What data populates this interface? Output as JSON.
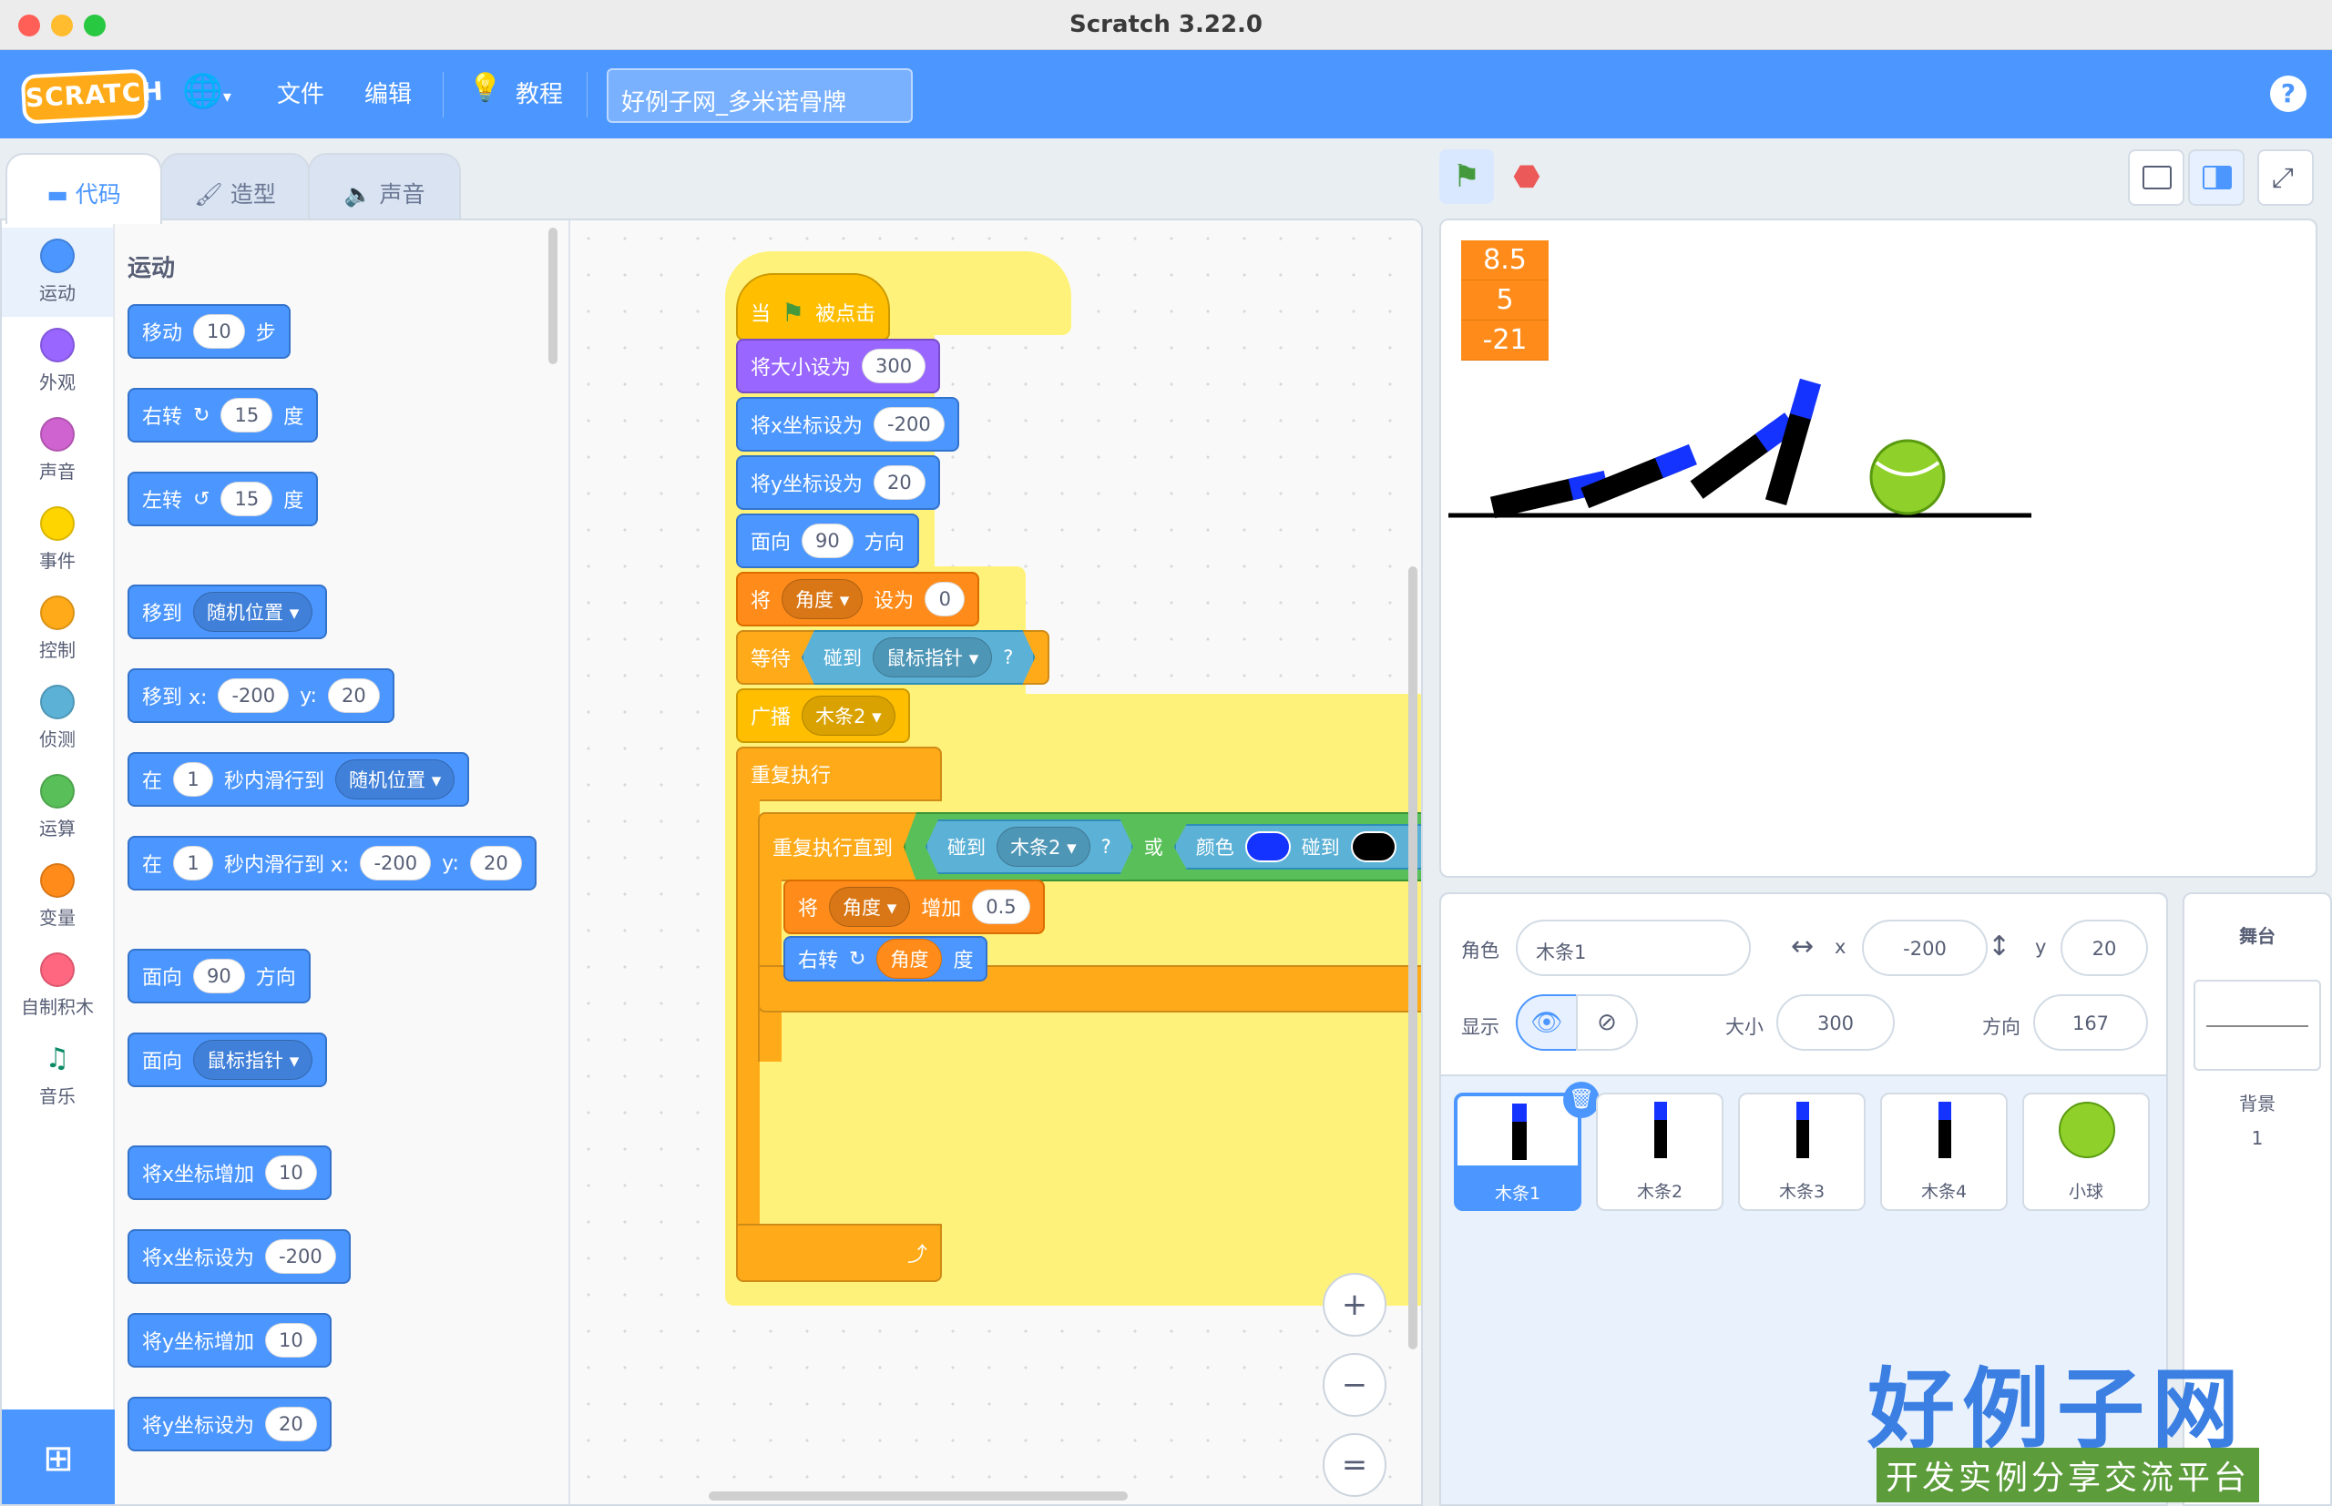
{
  "window": {
    "title": "Scratch 3.22.0"
  },
  "menubar": {
    "logo": "SCRATCH",
    "file": "文件",
    "edit": "编辑",
    "tutorials": "教程",
    "project_title": "好例子网_多米诺骨牌",
    "help": "?"
  },
  "tabs": {
    "code": "代码",
    "costumes": "造型",
    "sounds": "声音"
  },
  "categories": [
    {
      "label": "运动",
      "color": "#4c97ff"
    },
    {
      "label": "外观",
      "color": "#9966ff"
    },
    {
      "label": "声音",
      "color": "#cf63cf"
    },
    {
      "label": "事件",
      "color": "#ffd500"
    },
    {
      "label": "控制",
      "color": "#ffab19"
    },
    {
      "label": "侦测",
      "color": "#5cb1d6"
    },
    {
      "label": "运算",
      "color": "#59c059"
    },
    {
      "label": "变量",
      "color": "#ff8c1a"
    },
    {
      "label": "自制积木",
      "color": "#ff6680"
    },
    {
      "label": "音乐",
      "color": "#0fbd8c"
    }
  ],
  "palette": {
    "heading": "运动",
    "move": {
      "a": "移动",
      "v": "10",
      "b": "步"
    },
    "turn_right": {
      "a": "右转",
      "v": "15",
      "b": "度"
    },
    "turn_left": {
      "a": "左转",
      "v": "15",
      "b": "度"
    },
    "goto": {
      "a": "移到",
      "d": "随机位置"
    },
    "goto_xy": {
      "a": "移到 x:",
      "x": "-200",
      "b": "y:",
      "y": "20"
    },
    "glide": {
      "a": "在",
      "v": "1",
      "b": "秒内滑行到",
      "d": "随机位置"
    },
    "glide_xy": {
      "a": "在",
      "v": "1",
      "b": "秒内滑行到 x:",
      "x": "-200",
      "c": "y:",
      "y": "20"
    },
    "point_dir": {
      "a": "面向",
      "v": "90",
      "b": "方向"
    },
    "point_towards": {
      "a": "面向",
      "d": "鼠标指针"
    },
    "change_x": {
      "a": "将x坐标增加",
      "v": "10"
    },
    "set_x": {
      "a": "将x坐标设为",
      "v": "-200"
    },
    "change_y": {
      "a": "将y坐标增加",
      "v": "10"
    },
    "set_y": {
      "a": "将y坐标设为",
      "v": "20"
    }
  },
  "script": {
    "hat": {
      "a": "当",
      "b": "被点击"
    },
    "set_size": {
      "a": "将大小设为",
      "v": "300"
    },
    "set_x": {
      "a": "将x坐标设为",
      "v": "-200"
    },
    "set_y": {
      "a": "将y坐标设为",
      "v": "20"
    },
    "point": {
      "a": "面向",
      "v": "90",
      "b": "方向"
    },
    "set_var": {
      "a": "将",
      "var": "角度",
      "b": "设为",
      "v": "0"
    },
    "wait_until": {
      "a": "等待",
      "touch": "碰到",
      "target": "鼠标指针",
      "q": "?"
    },
    "broadcast": {
      "a": "广播",
      "msg": "木条2"
    },
    "forever": {
      "a": "重复执行"
    },
    "repeat_until": {
      "a": "重复执行直到",
      "touch": "碰到",
      "target": "木条2",
      "q": "?",
      "or": "或",
      "color": "颜色",
      "touch2": "碰到",
      "q2": "?"
    },
    "change_var": {
      "a": "将",
      "var": "角度",
      "b": "增加",
      "v": "0.5"
    },
    "turn": {
      "a": "右转",
      "var": "角度",
      "b": "度"
    },
    "colors": {
      "c1": "#1433ff",
      "c2": "#000000"
    }
  },
  "zoom": {
    "in": "+",
    "out": "−",
    "reset": "="
  },
  "stage": {
    "monitors": [
      "8.5",
      "5",
      "-21"
    ]
  },
  "sprite_info": {
    "sprite_label": "角色",
    "sprite_name": "木条1",
    "x_label": "x",
    "x": "-200",
    "y_label": "y",
    "y": "20",
    "show_label": "显示",
    "size_label": "大小",
    "size": "300",
    "direction_label": "方向",
    "direction": "167"
  },
  "sprites": [
    {
      "name": "木条1",
      "selected": true
    },
    {
      "name": "木条2"
    },
    {
      "name": "木条3"
    },
    {
      "name": "木条4"
    },
    {
      "name": "小球"
    }
  ],
  "stage_pane": {
    "title": "舞台",
    "backdrops_label": "背景",
    "backdrops": "1"
  },
  "watermark": {
    "big": "好例子网",
    "small": "开发实例分享交流平台"
  }
}
